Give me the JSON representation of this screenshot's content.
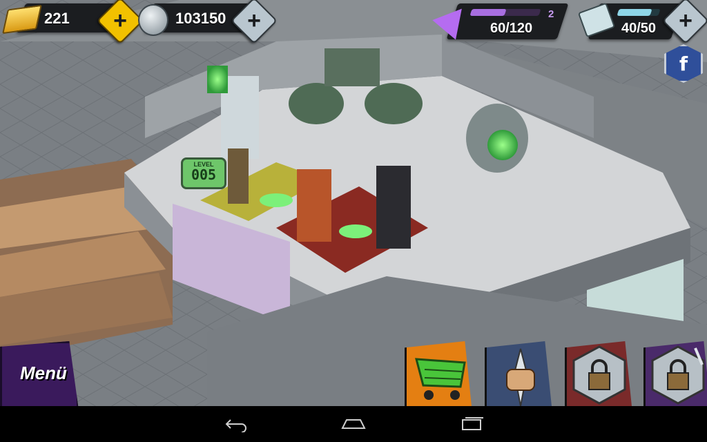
{
  "hud": {
    "gold": {
      "value": "221",
      "icon": "gold-bars-icon",
      "plus_icon": "plus-icon"
    },
    "coins": {
      "value": "103150",
      "icon": "silver-coins-icon",
      "plus_icon": "plus-icon"
    },
    "energy": {
      "value": "60/120",
      "level": "2",
      "icon": "purple-arrow-icon",
      "fill_ratio": 0.5
    },
    "tickets": {
      "value": "40/50",
      "icon": "ticket-icon",
      "fill_ratio": 0.8,
      "plus_icon": "plus-icon"
    },
    "facebook": {
      "label": "f",
      "icon": "facebook-icon"
    }
  },
  "scene": {
    "level_display": {
      "caption": "LEVEL",
      "value": "005"
    }
  },
  "bottom": {
    "menu_label": "Menü",
    "slots": [
      {
        "name": "shop",
        "icon": "shopping-cart-icon"
      },
      {
        "name": "fist-dagger",
        "icon": "fist-dagger-icon"
      },
      {
        "name": "locked-1",
        "icon": "lock-icon"
      },
      {
        "name": "locked-2",
        "icon": "lock-dagger-icon"
      }
    ]
  },
  "navbar": {
    "back_icon": "back-arrow-icon",
    "home_icon": "home-icon",
    "recents_icon": "recent-apps-icon"
  },
  "colors": {
    "gold_plus": "#f2c100",
    "silver_plus": "#b9c6cf",
    "energy_bar": "#a86ee0",
    "ticket_bar": "#8fd6e8",
    "menu_purple": "#3a1a5c"
  }
}
